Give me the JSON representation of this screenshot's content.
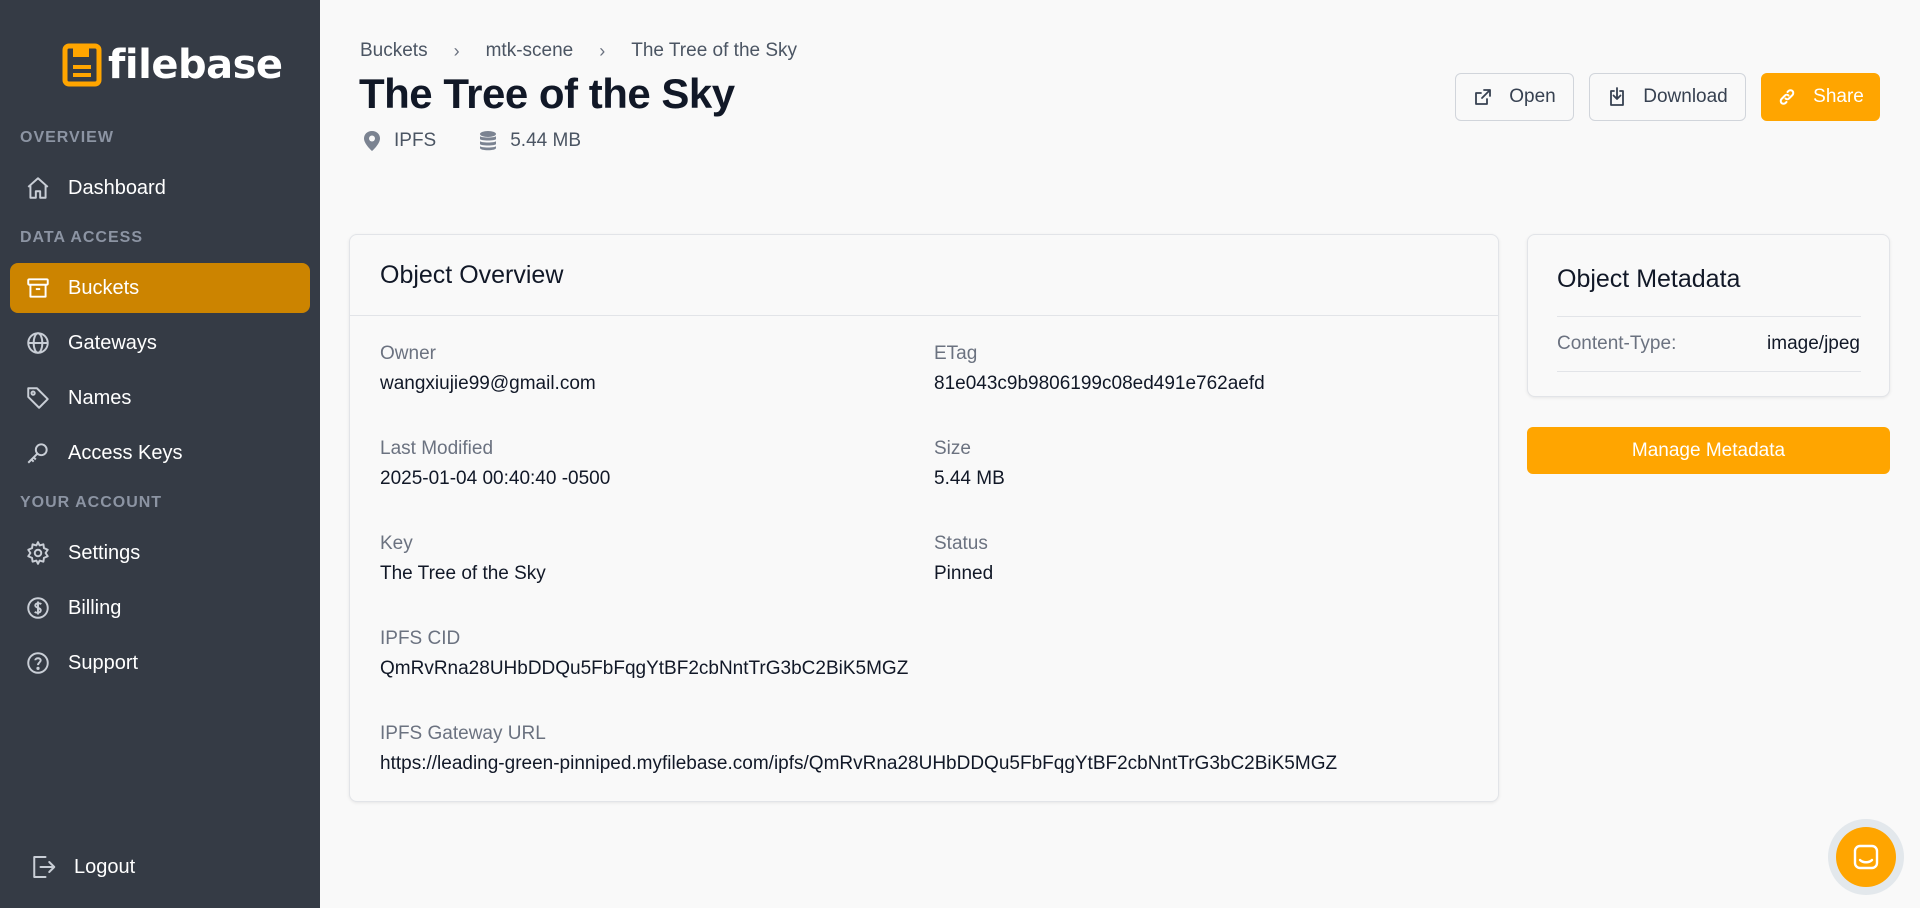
{
  "app": {
    "name": "filebase",
    "logo_icon": "filebase-logo-icon"
  },
  "colors": {
    "sidebar_bg": "#353b45",
    "accent": "#ffa500",
    "active_nav": "#cc8400"
  },
  "sidebar": {
    "sections": [
      {
        "label": "OVERVIEW",
        "items": [
          {
            "label": "Dashboard",
            "icon": "home-icon"
          }
        ]
      },
      {
        "label": "DATA ACCESS",
        "items": [
          {
            "label": "Buckets",
            "icon": "archive-icon",
            "active": true
          },
          {
            "label": "Gateways",
            "icon": "globe-icon"
          },
          {
            "label": "Names",
            "icon": "tag-icon"
          },
          {
            "label": "Access Keys",
            "icon": "key-icon"
          }
        ]
      },
      {
        "label": "YOUR ACCOUNT",
        "items": [
          {
            "label": "Settings",
            "icon": "gear-icon"
          },
          {
            "label": "Billing",
            "icon": "dollar-icon"
          },
          {
            "label": "Support",
            "icon": "question-icon"
          }
        ]
      }
    ],
    "logout": "Logout"
  },
  "breadcrumb": [
    "Buckets",
    "mtk-scene",
    "The Tree of the Sky"
  ],
  "header": {
    "title": "The Tree of the Sky",
    "network": "IPFS",
    "size": "5.44 MB",
    "buttons": {
      "open": "Open",
      "download": "Download",
      "share": "Share"
    }
  },
  "overview": {
    "title": "Object Overview",
    "fields": {
      "owner": {
        "label": "Owner",
        "value": "wangxiujie99@gmail.com"
      },
      "etag": {
        "label": "ETag",
        "value": "81e043c9b9806199c08ed491e762aefd"
      },
      "last_modified": {
        "label": "Last Modified",
        "value": "2025-01-04 00:40:40 -0500"
      },
      "size": {
        "label": "Size",
        "value": "5.44 MB"
      },
      "key": {
        "label": "Key",
        "value": "The Tree of the Sky"
      },
      "status": {
        "label": "Status",
        "value": "Pinned"
      },
      "cid": {
        "label": "IPFS CID",
        "value": "QmRvRna28UHbDDQu5FbFqgYtBF2cbNntTrG3bC2BiK5MGZ"
      },
      "gateway_url": {
        "label": "IPFS Gateway URL",
        "value": "https://leading-green-pinniped.myfilebase.com/ipfs/QmRvRna28UHbDDQu5FbFqgYtBF2cbNntTrG3bC2BiK5MGZ"
      }
    }
  },
  "metadata": {
    "title": "Object Metadata",
    "rows": [
      {
        "key": "Content-Type:",
        "value": "image/jpeg"
      }
    ],
    "manage_button": "Manage Metadata"
  }
}
